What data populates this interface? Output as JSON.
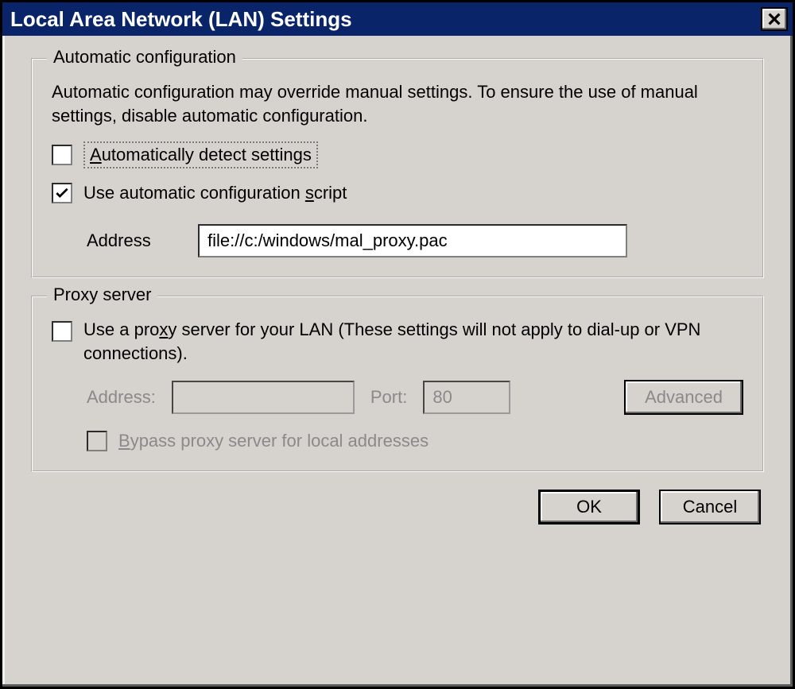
{
  "window": {
    "title": "Local Area Network (LAN) Settings",
    "close_glyph": "X"
  },
  "auto": {
    "legend": "Automatic configuration",
    "description": "Automatic configuration may override manual settings.  To ensure the use of manual settings, disable automatic configuration.",
    "detect": {
      "checked": false,
      "pre": "",
      "u": "A",
      "post": "utomatically detect settings"
    },
    "script": {
      "checked": true,
      "pre": "Use automatic configuration ",
      "u": "s",
      "post": "cript"
    },
    "address": {
      "label_pre": "Add",
      "label_u": "r",
      "label_post": "ess",
      "value": "file://c:/windows/mal_proxy.pac"
    }
  },
  "proxy": {
    "legend": "Proxy server",
    "use": {
      "checked": false,
      "pre": "Use a pro",
      "u": "x",
      "post": "y server for your LAN (These settings will not apply to dial-up or VPN connections)."
    },
    "address": {
      "label_pre": "Addr",
      "label_u": "e",
      "label_post": "ss:",
      "value": ""
    },
    "port": {
      "label_pre": "Por",
      "label_u": "t",
      "label_post": ":",
      "value": "80"
    },
    "advanced": {
      "pre": "Advan",
      "u": "c",
      "post": "ed"
    },
    "bypass": {
      "checked": false,
      "pre": "",
      "u": "B",
      "post": "ypass proxy server for local addresses"
    }
  },
  "buttons": {
    "ok": "OK",
    "cancel": "Cancel"
  }
}
